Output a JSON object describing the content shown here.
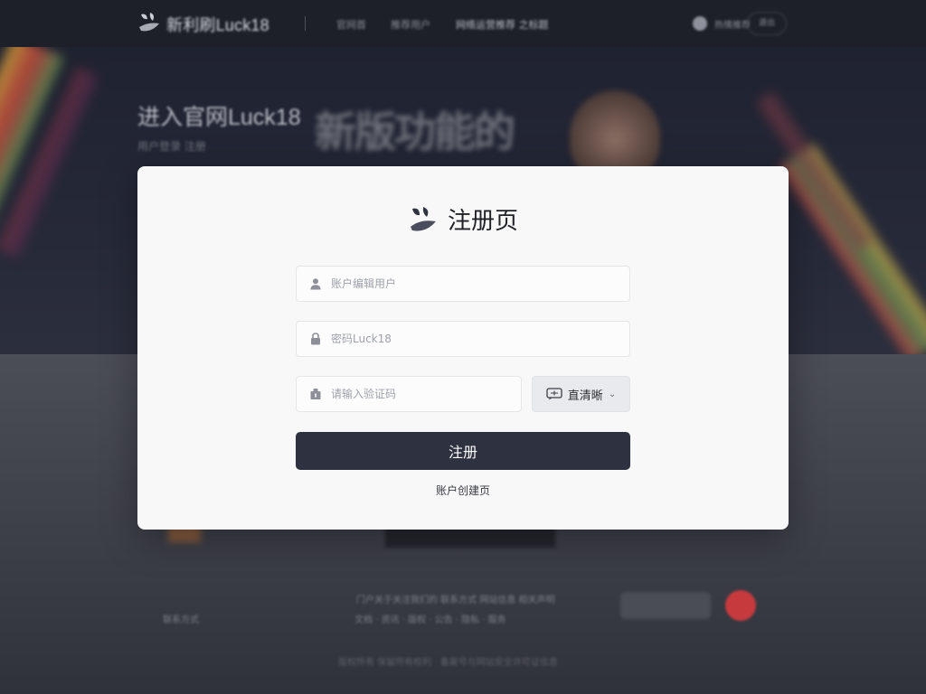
{
  "site": {
    "brand": "新利刷Luck18",
    "nav": [
      "官网首",
      "推荐用户",
      "网络运营推荐 之标题"
    ],
    "user_text": "热情推荐",
    "user_pill": "退出"
  },
  "hero": {
    "title": "进入官网Luck18",
    "subtitle": "用户登录 注册",
    "big_text": "新版功能的"
  },
  "footer": {
    "line1": "门户关于关注我们的 联系方式 网站信息 相关声明",
    "line2": "文档 · 资讯 · 版权 · 公告 · 隐私 · 服务",
    "left": "联系方式",
    "copyright": "版权所有 保留所有权利 · 备案号与网站安全许可证信息"
  },
  "modal": {
    "title": "注册页",
    "username_placeholder": "账户编辑用户",
    "password_placeholder": "密码Luck18",
    "code_placeholder": "请输入验证码",
    "captcha_label": "直清晰",
    "submit_label": "注册",
    "footer_link": "账户创建页"
  },
  "icons": {
    "user": "user-icon",
    "lock": "lock-icon",
    "code": "shield-icon",
    "captcha": "refresh-image-icon",
    "chevron": "chevron-down-icon"
  },
  "colors": {
    "submit_bg": "#2e3240",
    "modal_bg": "#f8f8f9",
    "page_dim": "#2a2c35"
  }
}
